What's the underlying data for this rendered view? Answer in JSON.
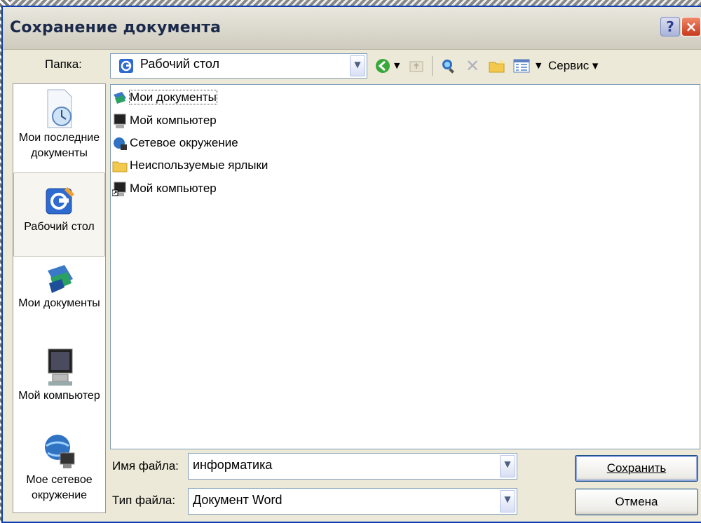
{
  "window": {
    "title": "Сохранение документа",
    "help_label": "?",
    "close_label": "×"
  },
  "toolbar": {
    "folder_label": "Папка:",
    "folder_value": "Рабочий стол",
    "service_label": "Сервис ▾"
  },
  "places": [
    {
      "label": "Мои последние документы",
      "icon": "recent-documents-icon"
    },
    {
      "label": "Рабочий стол",
      "icon": "desktop-icon",
      "selected": true
    },
    {
      "label": "Мои документы",
      "icon": "my-documents-icon"
    },
    {
      "label": "Мой компьютер",
      "icon": "my-computer-icon"
    },
    {
      "label": "Мое сетевое окружение",
      "icon": "network-places-icon"
    }
  ],
  "files": [
    {
      "name": "Мои документы",
      "icon": "my-documents-icon"
    },
    {
      "name": "Мой компьютер",
      "icon": "my-computer-icon"
    },
    {
      "name": "Сетевое окружение",
      "icon": "network-places-icon"
    },
    {
      "name": "Неиспользуемые ярлыки",
      "icon": "folder-icon"
    },
    {
      "name": "Мой компьютер",
      "icon": "computer-shortcut-icon"
    }
  ],
  "form": {
    "filename_label": "Имя файла:",
    "filename_value": "информатика",
    "filetype_label": "Тип файла:",
    "filetype_value": "Документ Word"
  },
  "buttons": {
    "save_label": "Сохранить",
    "cancel_label": "Отмена"
  }
}
